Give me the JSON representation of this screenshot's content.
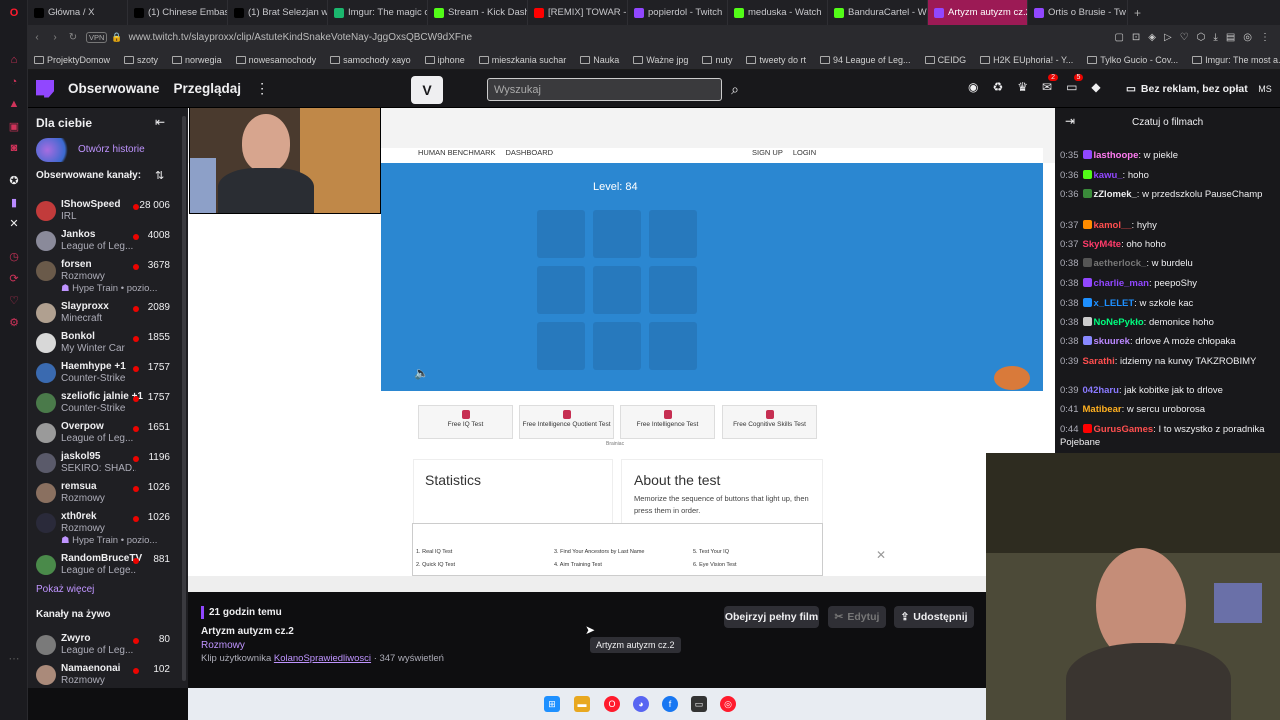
{
  "opera_sidebar": {
    "icons": [
      "opera-logo-icon",
      "home-icon",
      "clock-icon",
      "bag-icon",
      "ticket-icon",
      "chat-icon",
      "gamepad-icon",
      "twitch-icon",
      "x-icon",
      "history-icon",
      "clock-icon",
      "heart-icon",
      "settings-icon"
    ]
  },
  "tabs": [
    {
      "title": "Główna / X",
      "icon": "x-icon",
      "color": "#000000"
    },
    {
      "title": "(1) Chinese Embas",
      "icon": "x-icon",
      "color": "#000000"
    },
    {
      "title": "(1) Brat Selezjan w",
      "icon": "x-icon",
      "color": "#000000"
    },
    {
      "title": "Imgur: The magic o",
      "icon": "imgur-icon",
      "color": "#1bb76e"
    },
    {
      "title": "Stream - Kick Dash",
      "icon": "kick-icon",
      "color": "#53fc18"
    },
    {
      "title": "[REMIX] TOWAR -",
      "icon": "youtube-icon",
      "color": "#ff0000"
    },
    {
      "title": "popierdol - Twitch",
      "icon": "twitch-icon",
      "color": "#9147ff"
    },
    {
      "title": "meduska - Watch",
      "icon": "kick-icon",
      "color": "#53fc18"
    },
    {
      "title": "BanduraCartel - W",
      "icon": "kick-icon",
      "color": "#53fc18"
    },
    {
      "title": "Artyzm autyzm cz.2",
      "icon": "twitch-icon",
      "color": "#9147ff",
      "active": true
    },
    {
      "title": "Ortis o Brusie - Tw",
      "icon": "twitch-icon",
      "color": "#9147ff"
    }
  ],
  "address": {
    "vpn": "VPN",
    "url": "www.twitch.tv/slayproxx/clip/AstuteKindSnakeVoteNay-JggOxsQBCW9dXFne"
  },
  "bookmarks": [
    "ProjektyDomow",
    "szoty",
    "norwegia",
    "nowesamochody",
    "samochody xayo",
    "iphone",
    "mieszkania suchar",
    "Nauka",
    "Ważne jpg",
    "nuty",
    "tweety do rt",
    "94 League of Leg...",
    "CEIDG",
    "H2K EUphoria! - Y...",
    "Tylko Gucio - Cov...",
    "Imgur: The most a..."
  ],
  "twitch_nav": {
    "following": "Obserwowane",
    "browse": "Przeglądaj",
    "search_placeholder": "Wyszukaj",
    "badge_inbox": "2",
    "badge_notifications": "5",
    "ad_free": "Bez reklam, bez opłat",
    "avatar": "MS"
  },
  "left_sidebar": {
    "for_you": "Dla ciebie",
    "stories": "Otwórz historie",
    "followed": "Obserwowane kanały:",
    "show_more": "Pokaż więcej",
    "live_channels": "Kanały na żywo",
    "channels": [
      {
        "name": "IShowSpeed",
        "game": "IRL",
        "viewers": "28 006",
        "color": "#c23b3b"
      },
      {
        "name": "Jankos",
        "game": "League of Leg...",
        "viewers": "4008",
        "color": "#8a8a9a"
      },
      {
        "name": "forsen",
        "game": "Rozmowy",
        "viewers": "3678",
        "hype": "Hype Train • pozio...",
        "color": "#6a5a4a"
      },
      {
        "name": "Slayproxx",
        "game": "Minecraft",
        "viewers": "2089",
        "color": "#b0a090"
      },
      {
        "name": "Bonkol",
        "game": "My Winter Car",
        "viewers": "1855",
        "color": "#d8d8d8"
      },
      {
        "name": "Haemhype +1",
        "game": "Counter-Strike",
        "viewers": "1757",
        "color": "#3a6ab0"
      },
      {
        "name": "szeliofic jalnie +1",
        "game": "Counter-Strike",
        "viewers": "1757",
        "color": "#4a7a4a"
      },
      {
        "name": "Overpow",
        "game": "League of Leg...",
        "viewers": "1651",
        "color": "#9a9a9a"
      },
      {
        "name": "jaskol95",
        "game": "SEKIRO: SHAD...",
        "viewers": "1196",
        "color": "#5a5a6a"
      },
      {
        "name": "remsua",
        "game": "Rozmowy",
        "viewers": "1026",
        "color": "#8a7060"
      },
      {
        "name": "xth0rek",
        "game": "Rozmowy",
        "viewers": "1026",
        "hype": "Hype Train • pozio...",
        "color": "#2a2a3a"
      },
      {
        "name": "RandomBruceTV",
        "game": "League of Lege...",
        "viewers": "881",
        "color": "#4a8a4a"
      }
    ],
    "live": [
      {
        "name": "Zwyro",
        "game": "League of Leg...",
        "viewers": "80",
        "color": "#7a7a7a"
      },
      {
        "name": "Namaenonai",
        "game": "Rozmowy",
        "viewers": "102",
        "color": "#aa8a7a"
      }
    ]
  },
  "benchmark": {
    "nav": [
      "HUMAN BENCHMARK",
      "DASHBOARD"
    ],
    "auth": [
      "SIGN UP",
      "LOGIN"
    ],
    "level": "Level: 84",
    "ads": [
      "Free IQ Test",
      "Free Intelligence Quotient Test",
      "Free Intelligence Test",
      "Free Cognitive Skills Test"
    ],
    "ad_source": "Brainiac",
    "statistics": "Statistics",
    "about_title": "About the test",
    "about_text": "Memorize the sequence of buttons that light up, then press them in order.",
    "links": [
      "1. Real IQ Test",
      "3. Find Your Ancestors by Last Name",
      "5. Test Your IQ",
      "2. Quick IQ Test",
      "4. Aim Training Test",
      "6. Eye Vision Test"
    ]
  },
  "clip_info": {
    "time_ago": "21 godzin temu",
    "title": "Artyzm autyzm cz.2",
    "category": "Rozmowy",
    "clip_by": "Klip użytkownika",
    "author": "KolanoSprawiedliwosci",
    "views": "· 347 wyświetleń",
    "watch_full": "Obejrzyj pełny film",
    "edit": "Edytuj",
    "share": "Udostępnij",
    "tooltip": "Artyzm autyzm cz.2"
  },
  "chat": {
    "title": "Czatuj o filmach",
    "messages": [
      {
        "time": "0:35",
        "user": "lasthoope",
        "color": "#ff7cf2",
        "text": "w piekle",
        "badge": "#9147ff"
      },
      {
        "time": "0:36",
        "user": "kawu_",
        "color": "#9147ff",
        "text": "hoho",
        "badge": "#53fc18"
      },
      {
        "time": "0:36",
        "user": "zZlomek_",
        "color": "#efeff1",
        "text": "w przedszkolu PauseChamp",
        "badge": "#3a8a3a"
      },
      {
        "time": "0:37",
        "user": "kamol__",
        "color": "#ff4f4f",
        "text": "hyhy",
        "badge": "#ff8c00"
      },
      {
        "time": "0:37",
        "user": "SkyM4te",
        "color": "#ff3b6a",
        "text": "oho hoho",
        "badge": ""
      },
      {
        "time": "0:38",
        "user": "aetherlock_",
        "color": "#777777",
        "text": "w burdelu",
        "badge": "#555555"
      },
      {
        "time": "0:38",
        "user": "charlie_man",
        "color": "#9147ff",
        "text": "peepoShy",
        "badge": "#9147ff"
      },
      {
        "time": "0:38",
        "user": "x_LELET",
        "color": "#1e90ff",
        "text": "w szkole kac",
        "badge": "#1e90ff"
      },
      {
        "time": "0:38",
        "user": "NoNePykło",
        "color": "#00ff7f",
        "text": "demonice hoho",
        "badge": "#cccccc"
      },
      {
        "time": "0:38",
        "user": "skuurek",
        "color": "#bb88ff",
        "text": "drlove A może chłopaka",
        "badge": "#8888ff"
      },
      {
        "time": "0:39",
        "user": "Sarathi",
        "color": "#ff4f4f",
        "text": "idziemy na kurwy TAKZROBIMY",
        "badge": ""
      },
      {
        "time": "0:39",
        "user": "042haru",
        "color": "#8a7aff",
        "text": "jak kobitke jak to drlove",
        "badge": ""
      },
      {
        "time": "0:41",
        "user": "Matibear",
        "color": "#ffb020",
        "text": "w sercu uroborosa",
        "badge": ""
      },
      {
        "time": "0:44",
        "user": "GurusGames",
        "color": "#ff4f4f",
        "text": "I to wszystko z poradnika Pojebane",
        "badge": "#ff0000"
      }
    ]
  }
}
